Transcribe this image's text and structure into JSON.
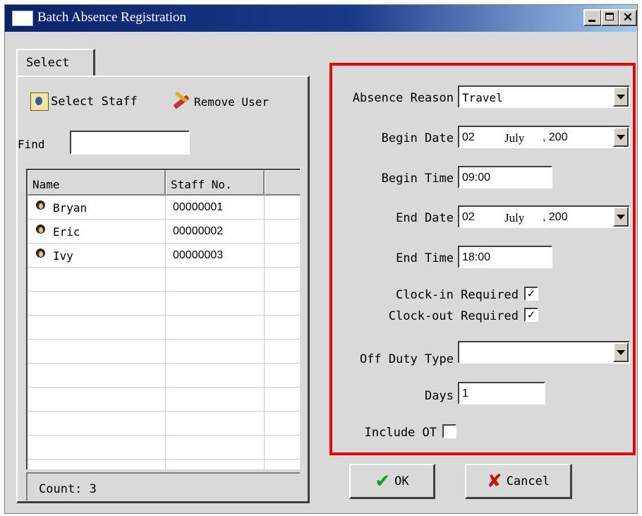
{
  "window": {
    "title": "Batch Absence Registration",
    "minimize_icon": "minimize-icon",
    "maximize_icon": "maximize-icon",
    "close_icon": "close-icon",
    "close_glyph": "✕"
  },
  "tabs": {
    "select_label": "Select"
  },
  "toolbar": {
    "select_staff_label": "Select Staff",
    "remove_user_label": "Remove User"
  },
  "find": {
    "label": "Find",
    "value": ""
  },
  "table": {
    "headers": [
      "Name",
      "Staff No."
    ],
    "rows": [
      {
        "name": "Bryan",
        "staff_no": "00000001"
      },
      {
        "name": "Eric",
        "staff_no": "00000002"
      },
      {
        "name": "Ivy",
        "staff_no": "00000003"
      }
    ]
  },
  "count": {
    "text": "Count: 3"
  },
  "form": {
    "absence_reason": {
      "label": "Absence Reason",
      "value": "Travel"
    },
    "begin_date": {
      "label": "Begin Date",
      "day": "02",
      "month": "July",
      "year": ", 200"
    },
    "begin_time": {
      "label": "Begin Time",
      "value": "09:00"
    },
    "end_date": {
      "label": "End Date",
      "day": "02",
      "month": "July",
      "year": ", 200"
    },
    "end_time": {
      "label": "End Time",
      "value": "18:00"
    },
    "clock_in": {
      "label": "Clock-in Required",
      "checked": true,
      "mark": "✓"
    },
    "clock_out": {
      "label": "Clock-out Required",
      "checked": true,
      "mark": "✓"
    },
    "off_duty_type": {
      "label": "Off Duty Type",
      "value": ""
    },
    "days": {
      "label": "Days",
      "value": "1"
    },
    "include_ot": {
      "label": "Include OT",
      "checked": false,
      "mark": ""
    }
  },
  "buttons": {
    "ok_label": "OK",
    "cancel_label": "Cancel",
    "ok_glyph": "✔",
    "cancel_glyph": "✘"
  },
  "colors": {
    "highlight_frame": "#e00000",
    "titlebar": "#0a246a",
    "window_bg": "#d9d9d9"
  }
}
